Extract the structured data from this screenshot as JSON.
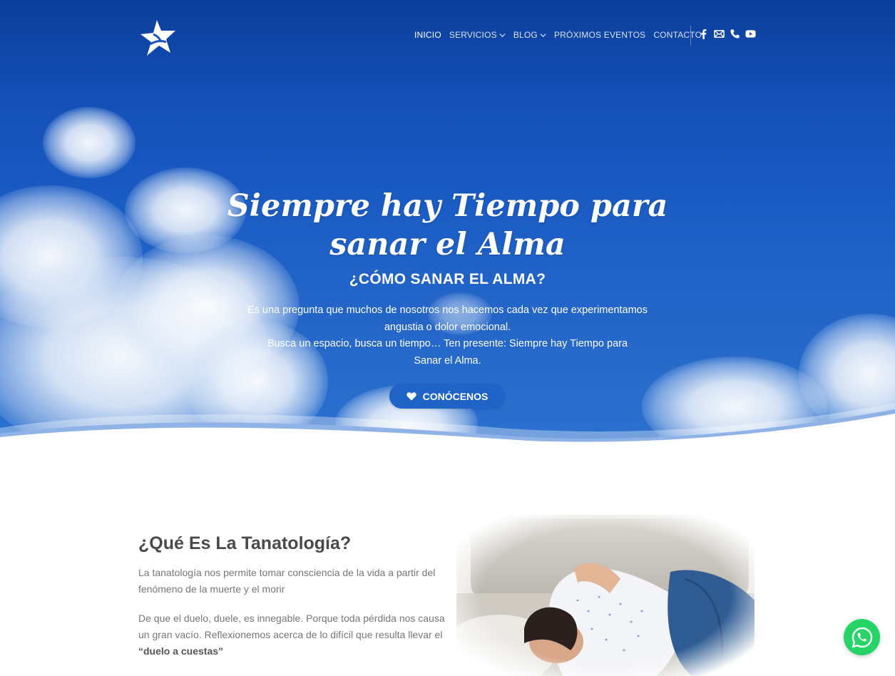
{
  "header": {
    "nav": [
      {
        "label": "INICIO",
        "active": true,
        "dropdown": false
      },
      {
        "label": "SERVICIOS",
        "active": false,
        "dropdown": true
      },
      {
        "label": "BLOG",
        "active": false,
        "dropdown": true
      },
      {
        "label": "PRÓXIMOS EVENTOS",
        "active": false,
        "dropdown": false
      },
      {
        "label": "CONTACTO",
        "active": false,
        "dropdown": false
      }
    ],
    "social_icons": [
      "facebook-icon",
      "email-icon",
      "phone-icon",
      "youtube-icon"
    ]
  },
  "hero": {
    "title": "Siempre hay Tiempo para sanar el Alma",
    "subtitle": "¿CÓMO SANAR EL ALMA?",
    "text_line1": "Es una pregunta que muchos de nosotros nos hacemos cada vez que experimentamos angustia o dolor emocional.",
    "text_line2": "Busca un espacio, busca un tiempo… Ten presente: Siempre hay Tiempo para Sanar el Alma.",
    "button_label": "CONÓCENOS"
  },
  "section": {
    "title": "¿Qué Es La Tanatología?",
    "para1": "La tanatología nos permite tomar consciencia de la vida a partir del fenómeno de la muerte y el morir",
    "para2_prefix": "De que el duelo, duele, es innegable. Porque toda pérdida nos causa un gran vacío. Reflexionemos acerca de lo difícil que resulta llevar el ",
    "para2_bold": "“duelo a cuestas”"
  },
  "colors": {
    "sky_top": "#0b3e9a",
    "sky_bottom": "#2c72cf",
    "button": "#1f63c7",
    "whatsapp": "#25d366",
    "heading": "#4a4a4a",
    "body_text": "#777777"
  }
}
